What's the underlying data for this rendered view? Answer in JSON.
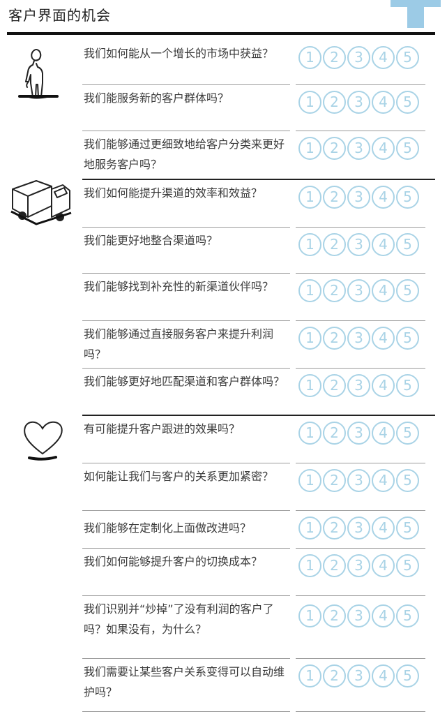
{
  "page": {
    "title": "客户界面的机会"
  },
  "colors": {
    "scale": "#a9d3e6",
    "corner_tab": "#9ccbe6",
    "rule": "#111111"
  },
  "scale_labels": [
    "1",
    "2",
    "3",
    "4",
    "5"
  ],
  "sections": [
    {
      "icon": "person-icon",
      "questions": [
        "我们如何能从一个增长的市场中获益？",
        "我们能服务新的客户群体吗？",
        "我们能够通过更细致地给客户分类来更好地服务客户吗？"
      ]
    },
    {
      "icon": "truck-icon",
      "questions": [
        "我们如何能提升渠道的效率和效益？",
        "我们能更好地整合渠道吗？",
        "我们能够找到补充性的新渠道伙伴吗？",
        "我们能够通过直接服务客户来提升利润吗？",
        "我们能够更好地匹配渠道和客户群体吗？"
      ]
    },
    {
      "icon": "heart-icon",
      "questions": [
        "有可能提升客户跟进的效果吗？",
        "如何能让我们与客户的关系更加紧密？",
        "我们能够在定制化上面做改进吗？",
        "我们如何能够提升客户的切换成本？",
        "我们识别并“炒掉”了没有利润的客户了吗？如果没有，为什么？",
        "我们需要让某些客户关系变得可以自动维护吗？"
      ]
    }
  ]
}
